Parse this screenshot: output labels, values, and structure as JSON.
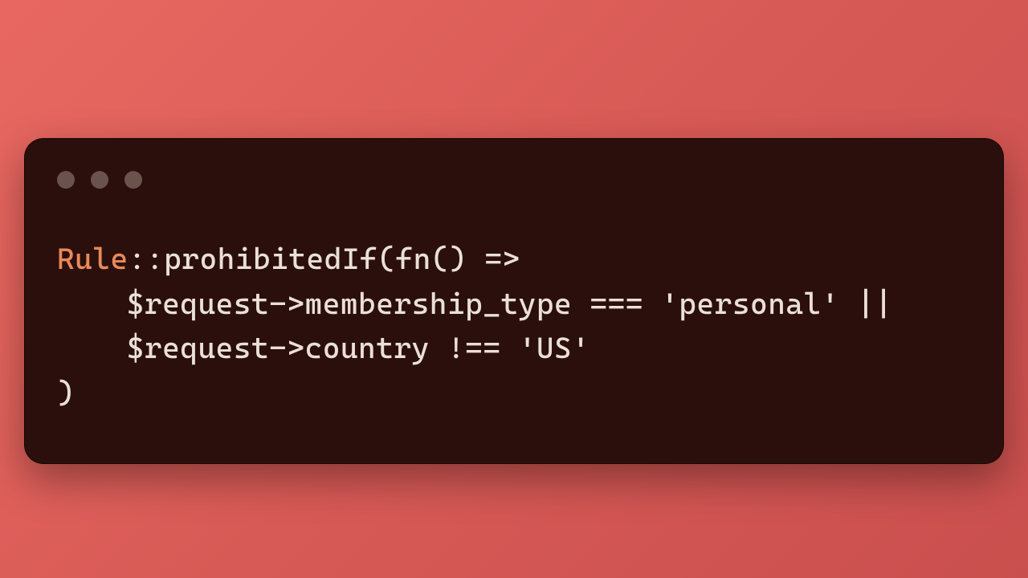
{
  "colors": {
    "background_start": "#e86861",
    "background_end": "#c94f4e",
    "window_bg": "#2b0f0c",
    "dot": "#6a524d",
    "text": "#eadfd9",
    "class_name": "#e88a5a"
  },
  "code": {
    "line1": {
      "class": "Rule",
      "scope": "::",
      "method": "prohibitedIf",
      "open": "(",
      "kw": "fn",
      "args": "()",
      "arrow": " =>"
    },
    "line2": {
      "var": "$request",
      "arrow": "->",
      "prop": "membership_type",
      "cmp": " === ",
      "str": "'personal'",
      "tail": " ||"
    },
    "line3": {
      "var": "$request",
      "arrow": "->",
      "prop": "country",
      "cmp": " !== ",
      "str": "'US'"
    },
    "line4": {
      "close": ")"
    }
  }
}
